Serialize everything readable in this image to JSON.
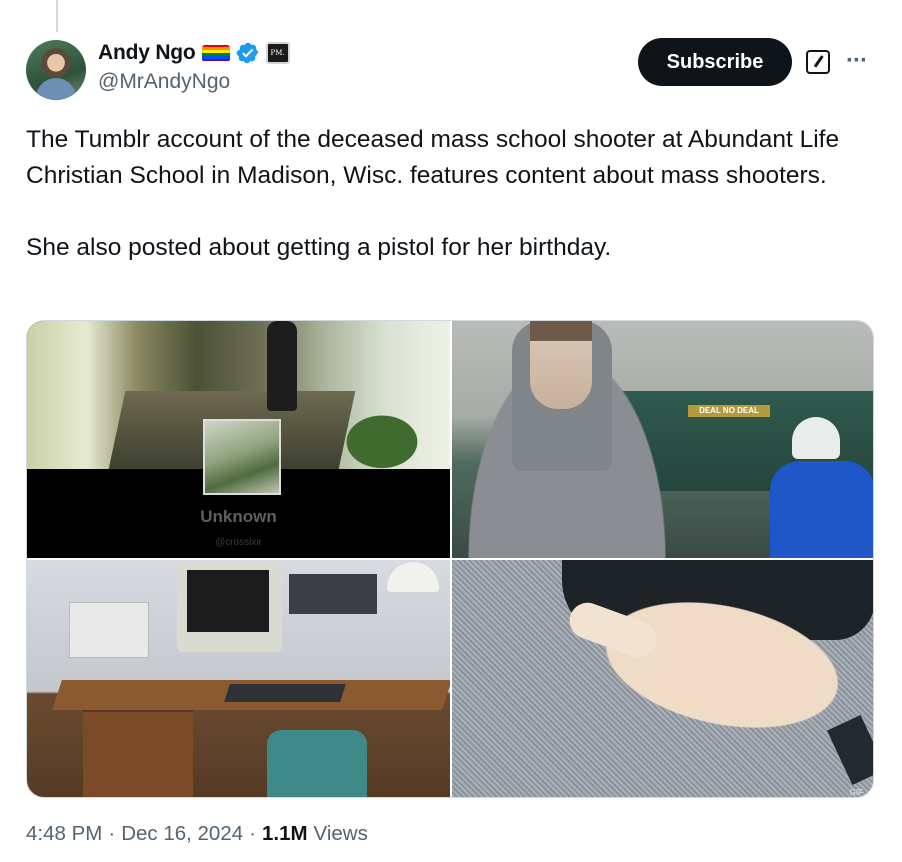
{
  "author": {
    "display_name": "Andy Ngo",
    "handle": "@MrAndyNgo",
    "affiliation_badge": "PM.",
    "badges": [
      "pride-flag-icon",
      "verified-icon",
      "affiliation-icon"
    ]
  },
  "actions": {
    "subscribe_label": "Subscribe",
    "grok_icon": "grok-icon",
    "more_icon": "more-icon"
  },
  "tweet": {
    "paragraphs": [
      "The Tumblr account of the deceased mass school shooter at Abundant Life Christian School in Madison, Wisc. features content about mass shooters.",
      "She also posted about getting a pistol for her birthday."
    ]
  },
  "media": {
    "tile1": {
      "caption": "Unknown",
      "credit": "@crossixir"
    },
    "tile2": {
      "sign": "DEAL NO DEAL"
    },
    "tile4": {
      "label": "GIF"
    }
  },
  "meta": {
    "time": "4:48 PM",
    "separator": "·",
    "date": "Dec 16, 2024",
    "views_count": "1.1M",
    "views_label": "Views"
  },
  "colors": {
    "text": "#0f1419",
    "secondary": "#536471",
    "verified": "#1d9bf0",
    "button": "#0f1419"
  }
}
